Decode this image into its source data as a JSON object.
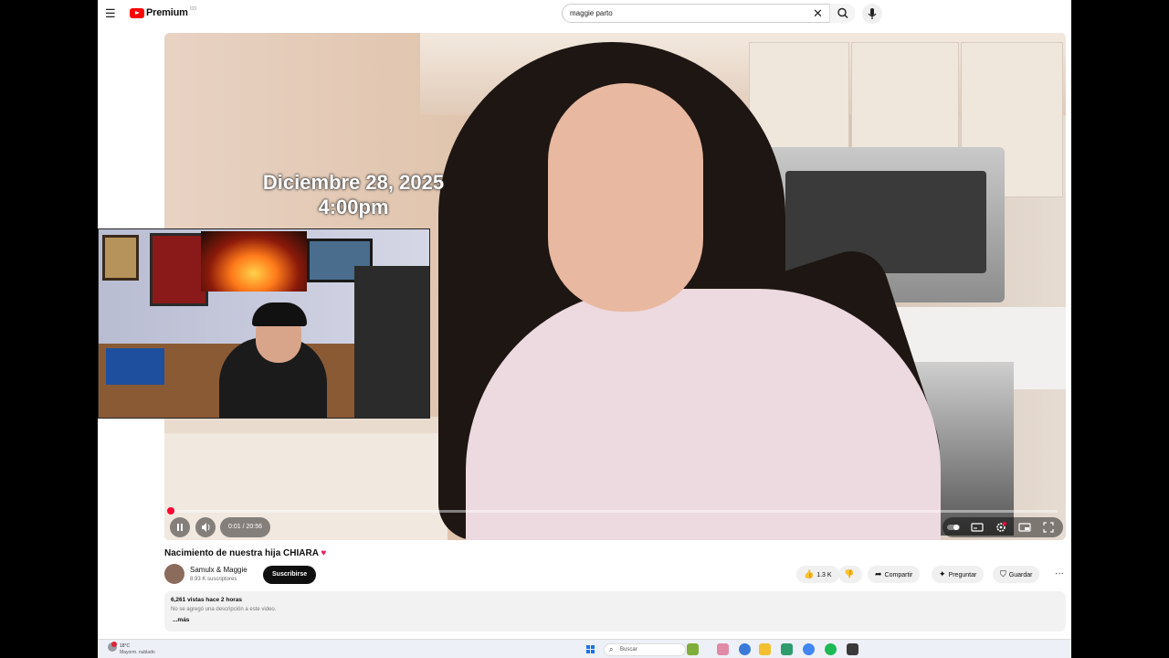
{
  "header": {
    "menu_icon": "hamburger-menu-icon",
    "logo_text": "Premium",
    "logo_sup": "CO",
    "search_value": "maggie parto",
    "clear_label": "✕",
    "search_icon": "search-icon",
    "mic_icon": "mic-icon"
  },
  "video": {
    "overlay_line1": "Diciembre 28, 2025",
    "overlay_line2": "4:00pm",
    "time": "0:01 / 20:56",
    "progress_fraction": 0.0008,
    "play_state_icon": "pause-icon",
    "volume_icon": "volume-icon",
    "controls_right": [
      "autoplay-toggle-icon",
      "subtitles-icon",
      "settings-icon",
      "miniplayer-icon",
      "fullscreen-icon"
    ],
    "accent_color": "#ff0033"
  },
  "meta": {
    "title": "Nacimiento de nuestra hija CHIARA",
    "title_emoji": "♥",
    "channel": "Samulx & Maggie",
    "subscribers": "8.93 K suscriptores",
    "subscribe_label": "Suscribirse",
    "likes": "1.3 K",
    "share_label": "Compartir",
    "ask_label": "Preguntar",
    "save_label": "Guardar",
    "more_label": "···"
  },
  "description": {
    "stats": "6,261 vistas  hace 2 horas",
    "text": "No se agregó una descripción a este video.",
    "more_label": "...más"
  },
  "taskbar": {
    "temperature": "18°C",
    "weather_desc": "Mayorm. nublado",
    "search_placeholder": "Buscar"
  }
}
